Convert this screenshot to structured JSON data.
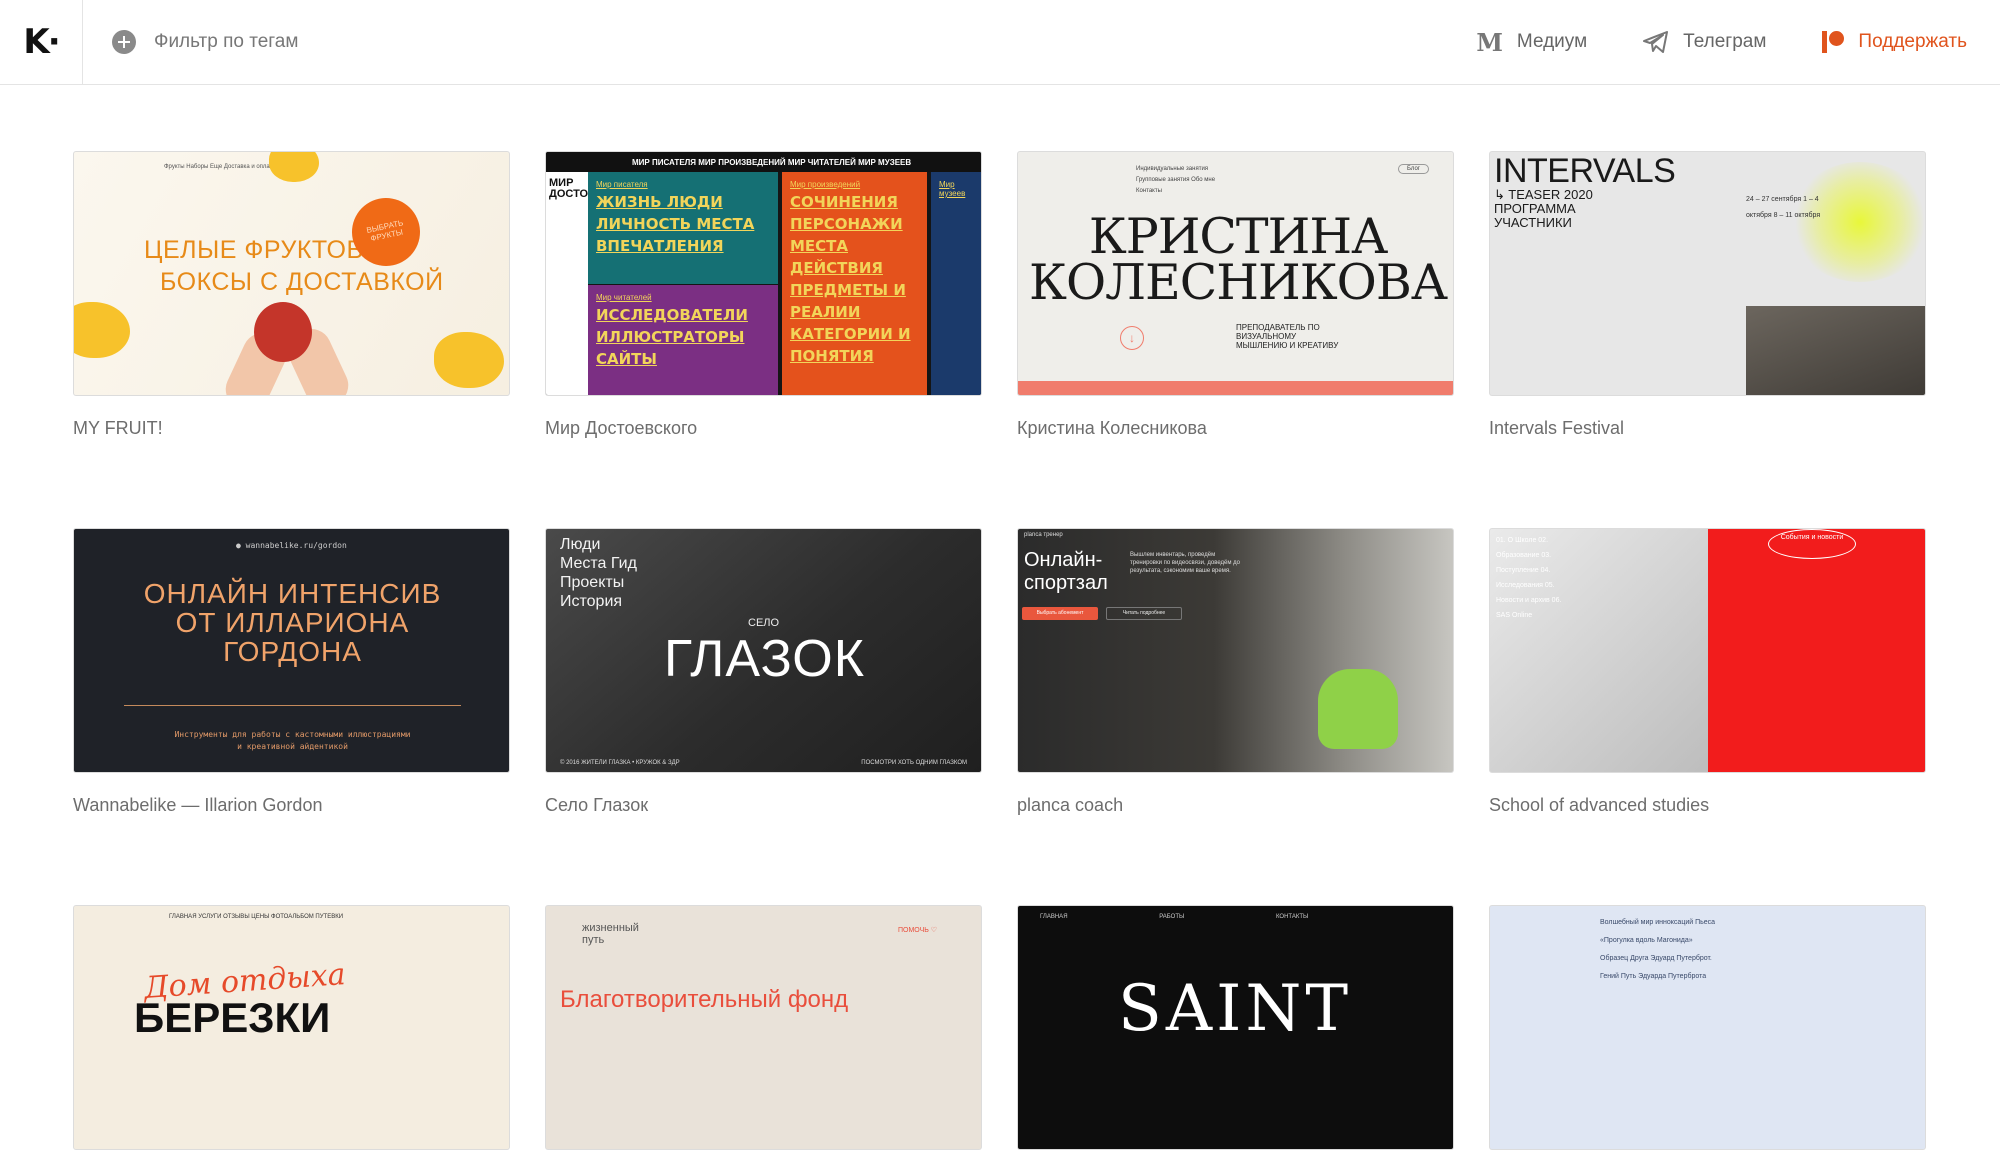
{
  "header": {
    "logo": "K·",
    "filter_label": "Фильтр по тегам",
    "nav": [
      {
        "label": "Медиум",
        "icon": "medium-icon"
      },
      {
        "label": "Телеграм",
        "icon": "telegram-icon"
      },
      {
        "label": "Поддержать",
        "icon": "patreon-icon"
      }
    ],
    "accent_color": "#e0541d"
  },
  "cards": [
    {
      "title": "MY FRUIT!",
      "thumb": {
        "nav": "Фрукты   Наборы   Еще   Доставка и оплата   Блог   Контакты",
        "headline_1": "ЦЕЛЫЕ ФРУКТОВЫЕ",
        "headline_2": "БОКСЫ С ДОСТАВКОЙ",
        "badge": "ВЫБРАТЬ ФРУКТЫ"
      }
    },
    {
      "title": "Мир Достоевского",
      "thumb": {
        "topbar": "МИР ПИСАТЕЛЯ   МИР ПРОИЗВЕДЕНИЙ   МИР ЧИТАТЕЛЕЙ   МИР МУЗЕЕВ",
        "logo": "МИР ДОСТОЕВСКОГО",
        "writer_label": "Мир писателя",
        "writer_items": "ЖИЗНЬ  ЛЮДИ ЛИЧНОСТЬ  МЕСТА ВПЕЧАТЛЕНИЯ",
        "readers_label": "Мир читателей",
        "readers_items": "ИССЛЕДОВАТЕЛИ ИЛЛЮСТРАТОРЫ САЙТЫ",
        "works_label": "Мир произведений",
        "works_items": "СОЧИНЕНИЯ ПЕРСОНАЖИ МЕСТА ДЕЙСТВИЯ ПРЕДМЕТЫ И РЕАЛИИ КАТЕГОРИИ И ПОНЯТИЯ",
        "museums_label": "Мир музеев"
      }
    },
    {
      "title": "Кристина Колесникова",
      "thumb": {
        "name_1": "КРИСТИНА",
        "name_2": "КОЛЕСНИКОВА",
        "caption": "ПРЕПОДАВАТЕЛЬ ПО ВИЗУАЛЬНОМУ МЫШЛЕНИЮ И КРЕАТИВУ",
        "menu": "Индивидуальные занятия  Групповые занятия  Обо мне  Контакты",
        "blog": "Блог"
      }
    },
    {
      "title": "Intervals Festival",
      "thumb": {
        "big": "INTERVALS",
        "sub": "↳ TEASER 2020 ПРОГРАММА УЧАСТНИКИ",
        "dates": "24 – 27 сентября   1 – 4 октября   8 – 11 октября"
      }
    },
    {
      "title": "Wannabelike — Illarion Gordon",
      "thumb": {
        "url": "● wannabelike.ru/gordon",
        "head_1": "ОНЛАЙН ИНТЕНСИВ",
        "head_2": "ОТ ИЛЛАРИОНА",
        "head_3": "ГОРДОНА",
        "small": "Инструменты для работы с кастомными иллюстрациями и креативной айдентикой"
      }
    },
    {
      "title": "Село Глазок",
      "thumb": {
        "menu": "Люди Места Гид Проекты История",
        "selo": "СЕЛО",
        "glazok": "ГЛАЗОК",
        "footer_left": "© 2016 ЖИТЕЛИ ГЛАЗКА • КРУЖОК & ЗДР",
        "footer_right": "ПОСМОТРИ ХОТЬ ОДНИМ ГЛАЗКОМ"
      }
    },
    {
      "title": "planca coach",
      "thumb": {
        "brand": "planca тренер",
        "head": "Онлайн- спортзал",
        "blurb": "Вышлем инвентарь, проведём тренировки по видеосвязи, доведём до результата, сэкономим ваше время.",
        "btn_primary": "Выбрать абонемент",
        "btn_secondary": "Читать подробнее"
      }
    },
    {
      "title": "School of advanced studies",
      "thumb": {
        "menu": "01. О Школе 02. Образование 03. Поступление 04. Исследования 05. Новости и архив 06. SAS Online",
        "events": "События и новости"
      }
    },
    {
      "title": "",
      "thumb": {
        "nav": "ГЛАВНАЯ  УСЛУГИ  ОТЗЫВЫ  ЦЕНЫ  ФОТОАЛЬБОМ  ПУТЕВКИ",
        "script": "Дом отдыха",
        "bold": "БЕРЕЗКИ"
      }
    },
    {
      "title": "",
      "thumb": {
        "logo": "жизненный путь",
        "help": "ПОМОЧЬ ♡",
        "fund": "Благотворительный фонд"
      }
    },
    {
      "title": "",
      "thumb": {
        "nav": "ГЛАВНАЯ   РАБОТЫ   КОНТАКТЫ",
        "saint": "SAINT"
      }
    },
    {
      "title": "",
      "thumb": {
        "lines": "Волшебный мир инноксаций  Пьеса «Прогулка вдоль Магонида»  Образец Друга  Эдуард Путерброт. Гений  Путь Эдуарда Путерброта"
      }
    }
  ]
}
